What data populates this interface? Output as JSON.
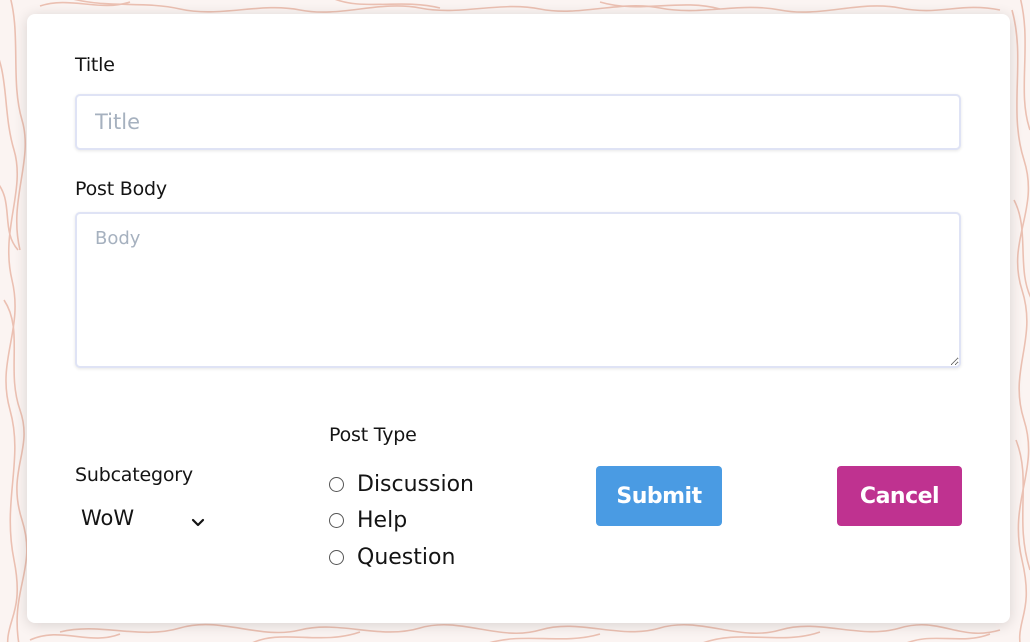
{
  "form": {
    "title_label": "Title",
    "title_placeholder": "Title",
    "title_value": "",
    "body_label": "Post Body",
    "body_placeholder": "Body",
    "body_value": "",
    "subcategory_label": "Subcategory",
    "subcategory_value": "WoW",
    "post_type_label": "Post Type",
    "post_types": [
      "Discussion",
      "Help",
      "Question"
    ],
    "selected_post_type": null,
    "submit_label": "Submit",
    "cancel_label": "Cancel"
  },
  "icons": {
    "subcategory_dropdown": "chevron-down-icon",
    "body_resize": "resize-handle-icon"
  },
  "colors": {
    "background": "#fbf4f2",
    "background_pattern": "#e9b8a8",
    "card": "#ffffff",
    "submit": "#4a9be3",
    "cancel": "#bf3290",
    "placeholder": "#a6b1bf",
    "input_border": "#dfe3f5"
  }
}
